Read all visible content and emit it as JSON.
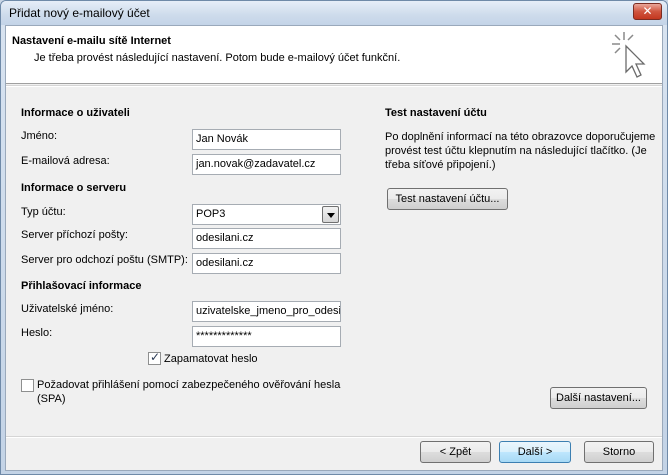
{
  "window": {
    "title": "Přidat nový e-mailový účet",
    "close_label": "✕"
  },
  "header": {
    "title": "Nastavení e-mailu sítě Internet",
    "subtitle": "Je třeba provést následující nastavení. Potom bude e-mailový účet funkční."
  },
  "user_info": {
    "heading": "Informace o uživateli",
    "name_label": "Jméno:",
    "name_value": "Jan Novák",
    "email_label": "E-mailová adresa:",
    "email_value": "jan.novak@zadavatel.cz"
  },
  "server_info": {
    "heading": "Informace o serveru",
    "account_type_label": "Typ účtu:",
    "account_type_value": "POP3",
    "incoming_label": "Server příchozí pošty:",
    "incoming_value": "odesilani.cz",
    "outgoing_label": "Server pro odchozí poštu (SMTP):",
    "outgoing_value": "odesilani.cz"
  },
  "login_info": {
    "heading": "Přihlašovací informace",
    "username_label": "Uživatelské jméno:",
    "username_value": "uzivatelske_jmeno_pro_odesila",
    "password_label": "Heslo:",
    "password_value": "*************",
    "remember_label": "Zapamatovat heslo",
    "remember_checked": true,
    "spa_label_line1": "Požadovat přihlášení pomocí zabezpečeného ověřování hesla",
    "spa_label_line2": "(SPA)",
    "spa_checked": false
  },
  "test": {
    "heading": "Test nastavení účtu",
    "description_lines": [
      "Po doplnění informací na této obrazovce doporučujeme",
      "provést test účtu klepnutím na následující tlačítko. (Je",
      "třeba síťové připojení.)"
    ],
    "test_button": "Test nastavení účtu..."
  },
  "buttons": {
    "more_settings": "Další nastavení...",
    "back": "< Zpět",
    "next": "Další >",
    "cancel": "Storno"
  }
}
